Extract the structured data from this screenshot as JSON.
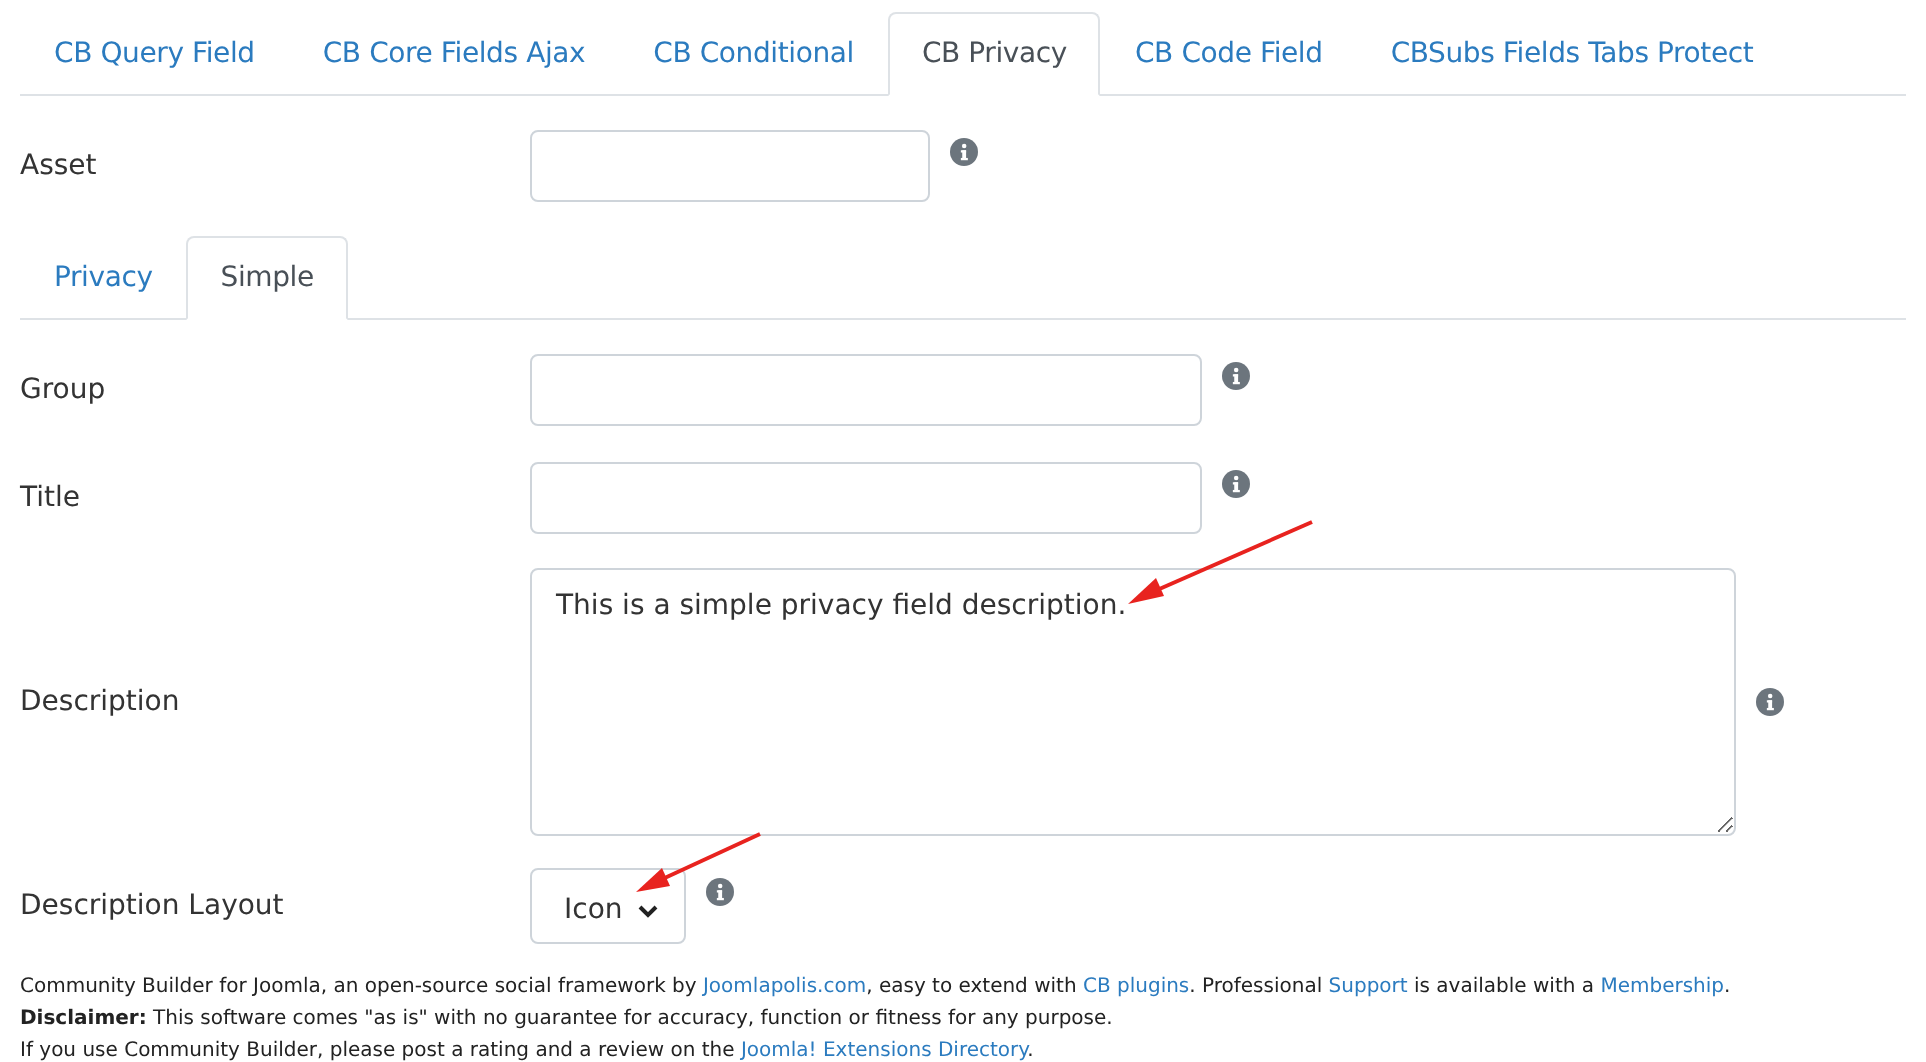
{
  "tabs": [
    {
      "label": "CB Query Field",
      "selected": false
    },
    {
      "label": "CB Core Fields Ajax",
      "selected": false
    },
    {
      "label": "CB Conditional",
      "selected": false
    },
    {
      "label": "CB Privacy",
      "selected": true
    },
    {
      "label": "CB Code Field",
      "selected": false
    },
    {
      "label": "CBSubs Fields Tabs Protect",
      "selected": false
    }
  ],
  "asset": {
    "label": "Asset"
  },
  "subtabs": [
    {
      "label": "Privacy",
      "selected": false
    },
    {
      "label": "Simple",
      "selected": true
    }
  ],
  "fields": [
    {
      "kind": "input",
      "label": "Group"
    },
    {
      "kind": "input",
      "label": "Title"
    },
    {
      "kind": "textarea",
      "label": "Description",
      "value": "This is a simple privacy field description."
    },
    {
      "kind": "select",
      "label": "Description Layout",
      "value": "Icon"
    }
  ],
  "footer": [
    {
      "parts": [
        {
          "text": "Community Builder for Joomla, an open-source social framework by "
        },
        {
          "text": "Joomlapolis.com",
          "link": true
        },
        {
          "text": ", easy to extend with "
        },
        {
          "text": "CB plugins",
          "link": true
        },
        {
          "text": ". Professional "
        },
        {
          "text": "Support",
          "link": true
        },
        {
          "text": " is available with a "
        },
        {
          "text": "Membership",
          "link": true
        },
        {
          "text": "."
        }
      ]
    },
    {
      "parts": [
        {
          "text": "**Disclaimer:** This software comes \"as is\" with no guarantee for accuracy, function or fitness for any purpose."
        }
      ]
    },
    {
      "parts": [
        {
          "text": "If you use Community Builder, please post a rating and a review on the "
        },
        {
          "text": "Joomla! Extensions Directory",
          "link": true
        },
        {
          "text": "."
        }
      ]
    }
  ]
}
